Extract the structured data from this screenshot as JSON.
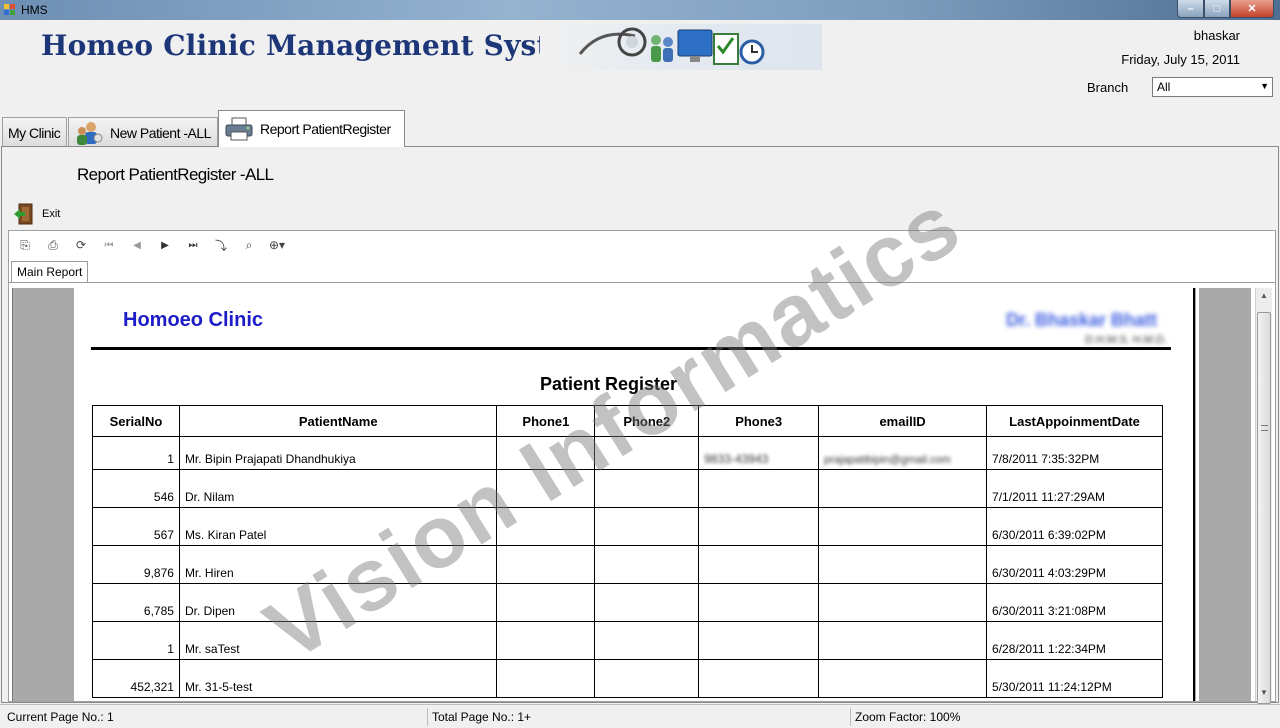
{
  "window": {
    "title": "HMS",
    "controls": {
      "minimize": "–",
      "maximize": "□",
      "close": "✕"
    }
  },
  "header": {
    "app_title": "Homeo Clinic Management System",
    "user": "bhaskar",
    "date": "Friday, July 15, 2011",
    "branch_label": "Branch",
    "branch_value": "All"
  },
  "tabs": [
    {
      "label": "My Clinic",
      "icon": "none"
    },
    {
      "label": "New Patient -ALL",
      "icon": "users-icon"
    },
    {
      "label": "Report PatientRegister",
      "icon": "printer-icon",
      "active": true
    }
  ],
  "content": {
    "report_title": "Report PatientRegister -ALL",
    "exit_label": "Exit"
  },
  "viewer": {
    "toolbar": [
      {
        "name": "export-icon",
        "glyph": "⎘"
      },
      {
        "name": "print-icon",
        "glyph": "⎙"
      },
      {
        "name": "refresh-icon",
        "glyph": "⟳"
      },
      {
        "name": "first-page-icon",
        "glyph": "⏮"
      },
      {
        "name": "prev-page-icon",
        "glyph": "◀"
      },
      {
        "name": "next-page-icon",
        "glyph": "▶"
      },
      {
        "name": "last-page-icon",
        "glyph": "⏭"
      },
      {
        "name": "goto-page-icon",
        "glyph": "⤵"
      },
      {
        "name": "find-icon",
        "glyph": "⌕"
      },
      {
        "name": "zoom-icon",
        "glyph": "⊕▾"
      }
    ],
    "tab_label": "Main Report"
  },
  "report": {
    "clinic_name": "Homoeo Clinic",
    "doctor_name": "Dr. Bhaskar Bhatt",
    "doctor_sub": "D.H.M.S. H.M.D.",
    "title": "Patient Register",
    "columns": [
      "SerialNo",
      "PatientName",
      "Phone1",
      "Phone2",
      "Phone3",
      "emailID",
      "LastAppoinmentDate"
    ],
    "rows": [
      {
        "serial": "1",
        "name": "Mr. Bipin Prajapati Dhandhukiya",
        "phone1": "",
        "phone2": "",
        "phone3": "9833-43943",
        "email": "prajapatibipin@gmail.com",
        "date": "7/8/2011   7:35:32PM"
      },
      {
        "serial": "546",
        "name": "Dr. Nilam",
        "phone1": "",
        "phone2": "",
        "phone3": "",
        "email": "",
        "date": "7/1/2011  11:27:29AM"
      },
      {
        "serial": "567",
        "name": "Ms. Kiran  Patel",
        "phone1": "",
        "phone2": "",
        "phone3": "",
        "email": "",
        "date": "6/30/2011   6:39:02PM"
      },
      {
        "serial": "9,876",
        "name": "Mr. Hiren",
        "phone1": "",
        "phone2": "",
        "phone3": "",
        "email": "",
        "date": "6/30/2011   4:03:29PM"
      },
      {
        "serial": "6,785",
        "name": "Dr. Dipen",
        "phone1": "",
        "phone2": "",
        "phone3": "",
        "email": "",
        "date": "6/30/2011   3:21:08PM"
      },
      {
        "serial": "1",
        "name": "Mr. saTest",
        "phone1": "",
        "phone2": "",
        "phone3": "",
        "email": "",
        "date": "6/28/2011   1:22:34PM"
      },
      {
        "serial": "452,321",
        "name": "Mr. 31-5-test",
        "phone1": "",
        "phone2": "",
        "phone3": "",
        "email": "",
        "date": "5/30/2011  11:24:12PM"
      }
    ]
  },
  "statusbar": {
    "current_page": "Current Page No.: 1",
    "total_page": "Total Page No.: 1+",
    "zoom": "Zoom Factor: 100%"
  },
  "watermark": "Vision Informatics",
  "colors": {
    "heading": "#1d3677",
    "clinic": "#1d1dc8"
  }
}
